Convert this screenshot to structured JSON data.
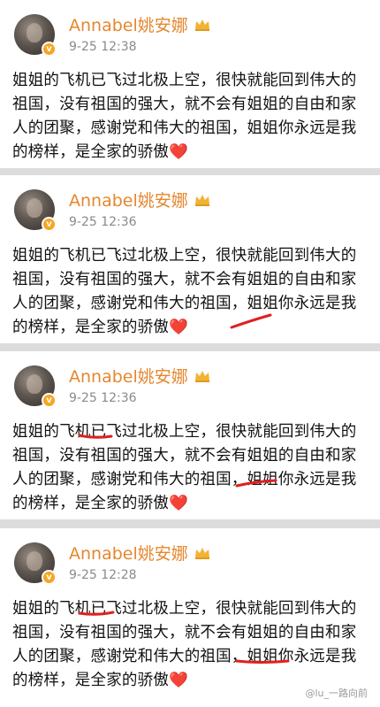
{
  "posts": [
    {
      "user": "Annabel姚安娜",
      "time": "9-25 12:38",
      "text": "姐姐的飞机已飞过北极上空，很快就能回到伟大的祖国，没有祖国的强大，就不会有姐姐的自由和家人的团聚，感谢党和伟大的祖国，姐姐你永远是我的榜样，是全家的骄傲",
      "emoji": "❤️"
    },
    {
      "user": "Annabel姚安娜",
      "time": "9-25 12:36",
      "text": "姐姐的飞机已飞过北极上空，很快就能回到伟大的祖国，没有祖国的强大，就不会有姐姐的自由和家人的团聚，感谢党和伟大的祖国，姐姐你永远是我的榜样，是全家的骄傲",
      "emoji": "❤️"
    },
    {
      "user": "Annabel姚安娜",
      "time": "9-25 12:36",
      "text": "姐姐的飞机已飞过北极上空，很快就能回到伟大的祖国，没有祖国的强大，就不会有姐姐的自由和家人的团聚，感谢党和伟大的祖国，姐姐你永远是我的榜样，是全家的骄傲",
      "emoji": "❤️"
    },
    {
      "user": "Annabel姚安娜",
      "time": "9-25 12:28",
      "text": "姐姐的飞机已飞过北极上空，很快就能回到伟大的祖国，没有祖国的强大，就不会有姐姐的自由和家人的团聚，感谢党和伟大的祖国，姐姐你永远是我的榜样，是全家的骄傲",
      "emoji": "❤️"
    }
  ],
  "watermark": "@lu_一路向前",
  "colors": {
    "username": "#e5872e",
    "annotation": "#e02020",
    "badge": "#f5a623"
  }
}
